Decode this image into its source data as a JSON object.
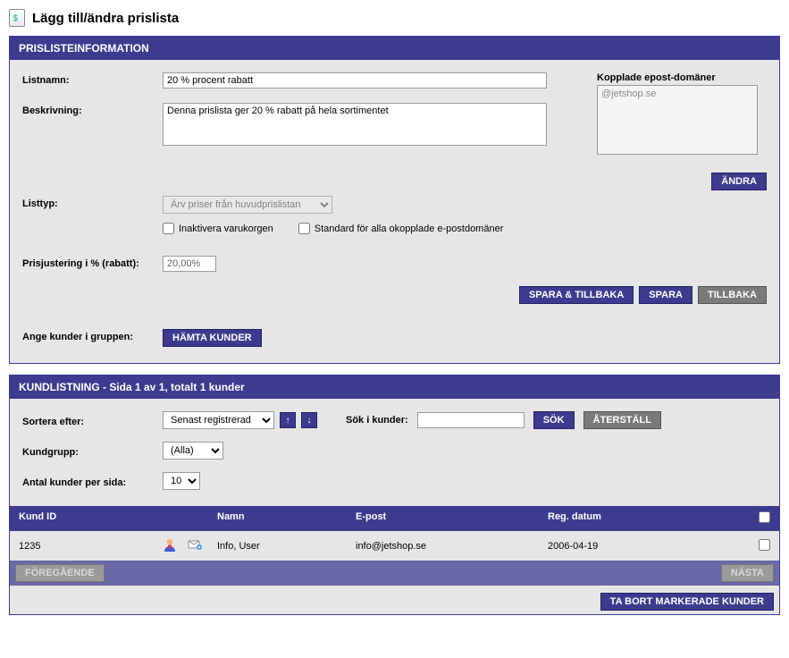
{
  "page_title": "Lägg till/ändra prislista",
  "info": {
    "header": "PRISLISTEINFORMATION",
    "labels": {
      "listname": "Listnamn:",
      "description": "Beskrivning:",
      "email_domains": "Kopplade epost-domäner",
      "listtype": "Listtyp:",
      "price_adjust": "Prisjustering i % (rabatt):",
      "assign_group": "Ange kunder i gruppen:"
    },
    "values": {
      "listname": "20 % procent rabatt",
      "description": "Denna prislista ger 20 % rabatt på hela sortimentet",
      "email_domain_placeholder": "@jetshop.se",
      "listtype": "Ärv priser från huvudprislistan",
      "price_adjust": "20,00%"
    },
    "checkboxes": {
      "inactivate_cart": "Inaktivera varukorgen",
      "default_unlinked": "Standard för alla okopplade e-postdomäner"
    },
    "buttons": {
      "change": "ÄNDRA",
      "save_back": "SPARA & TILLBAKA",
      "save": "SPARA",
      "back": "TILLBAKA",
      "fetch_customers": "HÄMTA KUNDER"
    }
  },
  "listing": {
    "header": "KUNDLISTNING - Sida 1 av 1, totalt 1 kunder",
    "labels": {
      "sort_by": "Sortera efter:",
      "search": "Sök i kunder:",
      "customer_group": "Kundgrupp:",
      "per_page": "Antal kunder per sida:"
    },
    "values": {
      "sort_by": "Senast registrerad",
      "customer_group": "(Alla)",
      "per_page": "10"
    },
    "buttons": {
      "search": "SÖK",
      "reset": "ÅTERSTÄLL",
      "prev": "FÖREGÅENDE",
      "next": "NÄSTA",
      "delete_marked": "TA BORT MARKERADE KUNDER"
    },
    "columns": {
      "id": "Kund ID",
      "name": "Namn",
      "email": "E-post",
      "reg_date": "Reg. datum"
    },
    "rows": [
      {
        "id": "1235",
        "name": "Info, User",
        "email": "info@jetshop.se",
        "reg_date": "2006-04-19"
      }
    ]
  }
}
